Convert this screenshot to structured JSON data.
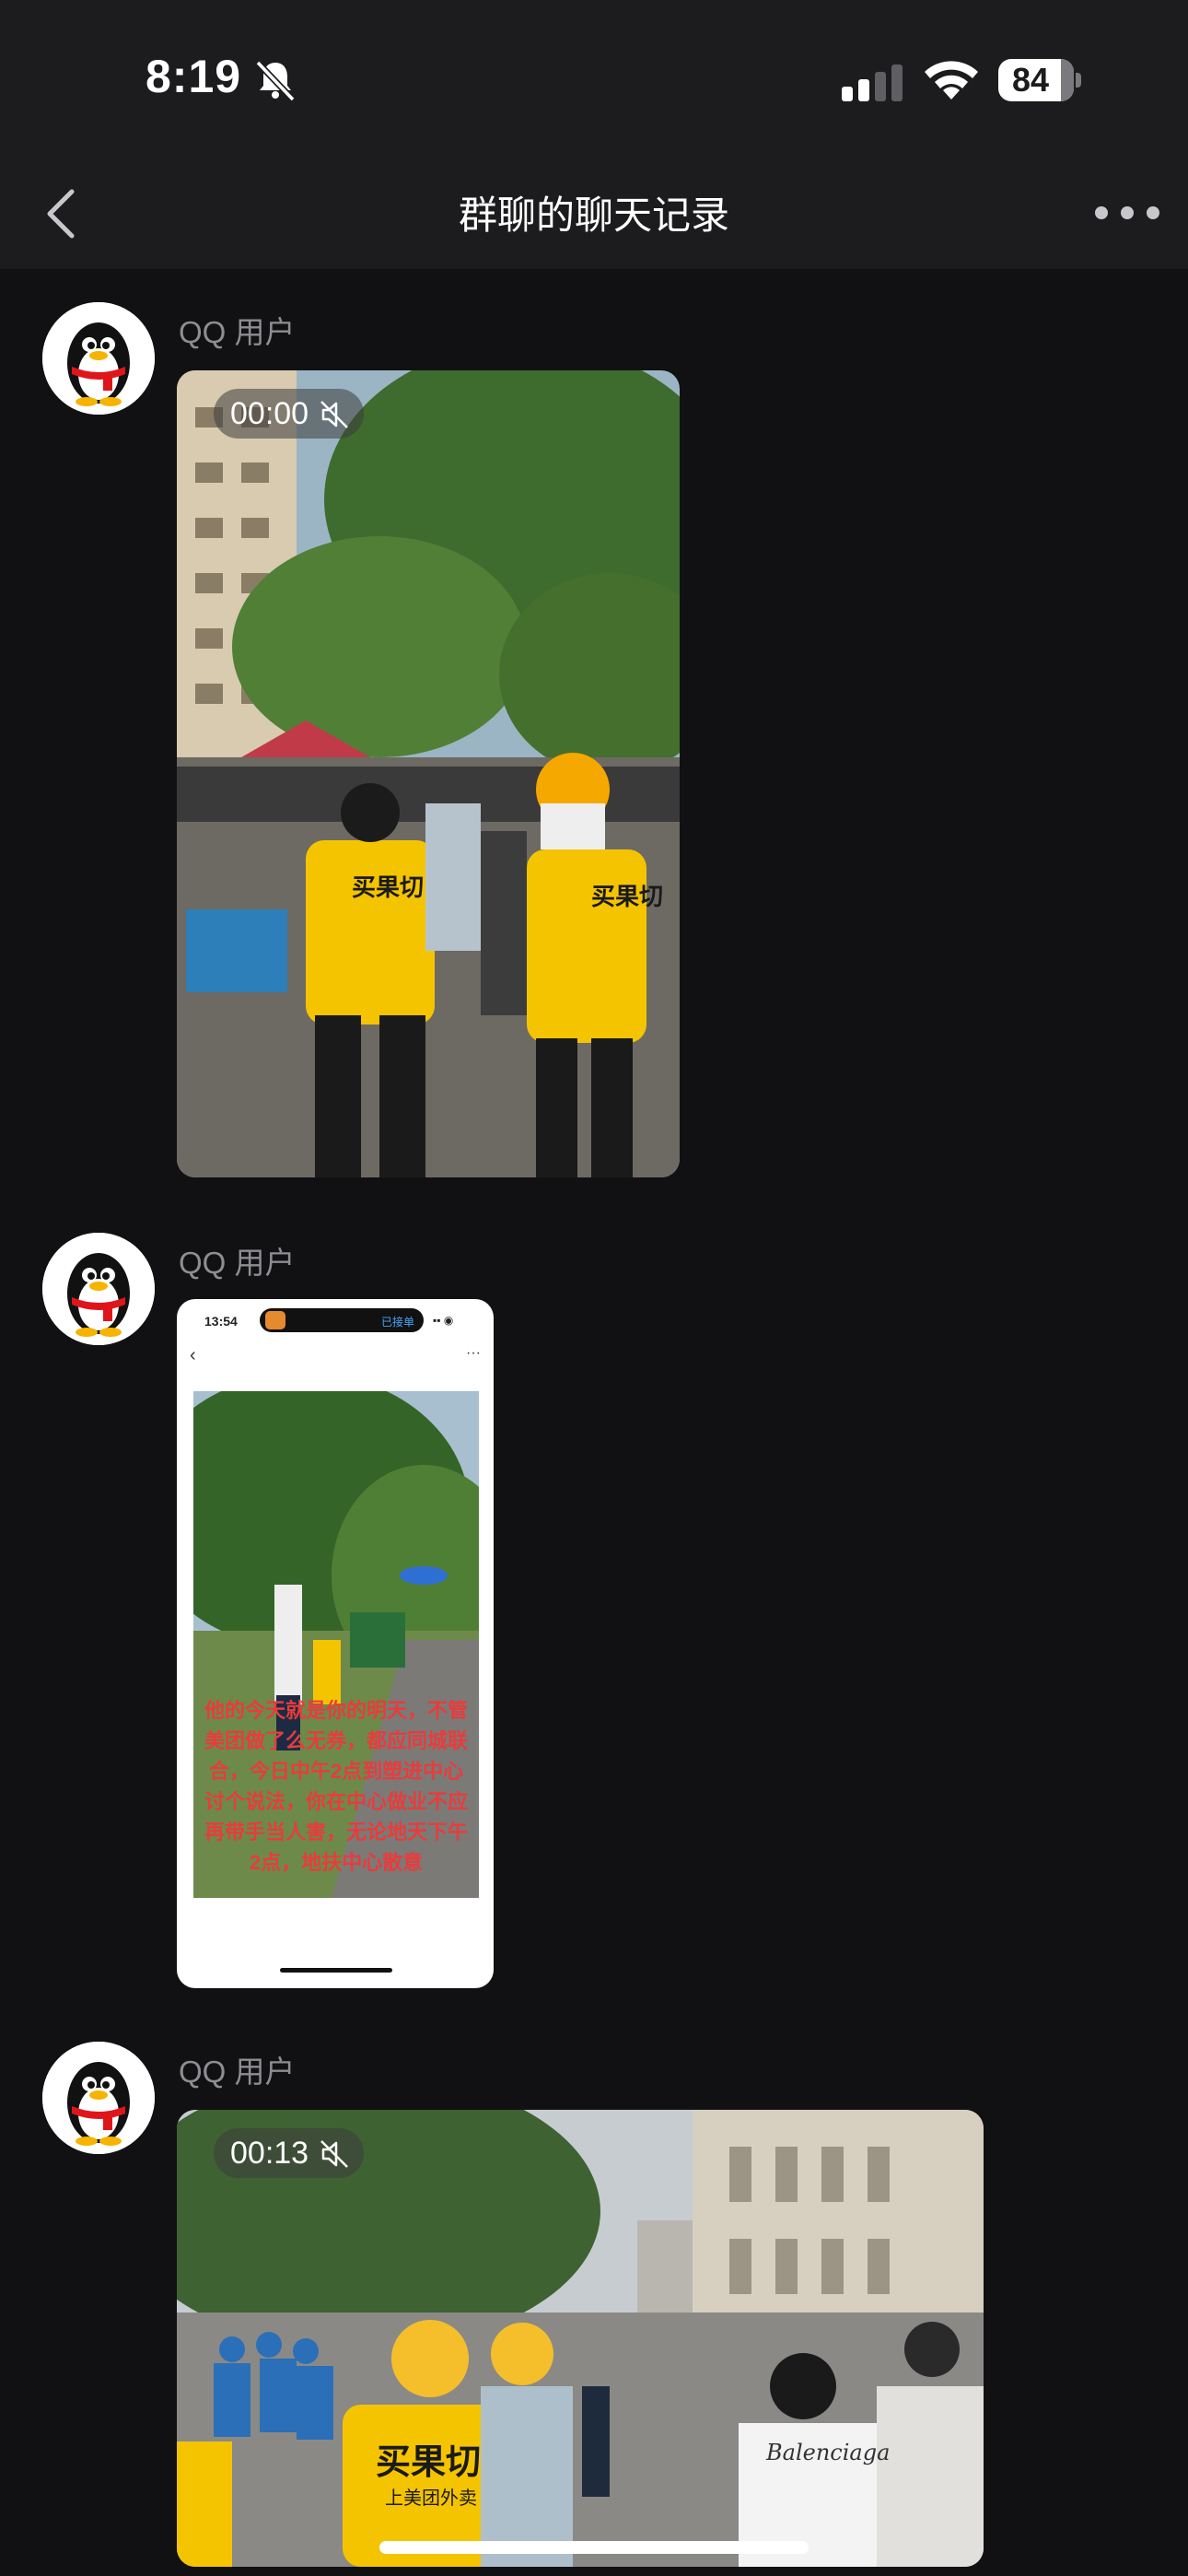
{
  "status_bar": {
    "time": "8:19",
    "battery": "84"
  },
  "nav": {
    "title": "群聊的聊天记录"
  },
  "messages": [
    {
      "sender": "QQ 用户",
      "video_time": "00:00"
    },
    {
      "sender": "QQ 用户",
      "screenshot": {
        "status_time": "13:54",
        "order_status": "已接单",
        "caption": "他的今天就是你的明天，不管美团做了么无券，都应同城联合，今日中午2点到塑进中心讨个说法，你在中心做业不应再带手当人害，无论地天下午2点，地扶中心散意"
      }
    },
    {
      "sender": "QQ 用户",
      "video_time": "00:13",
      "jersey_text": "买果切",
      "jersey_sub": "上美团外卖"
    }
  ],
  "colors": {
    "background": "#111113",
    "bar": "#1c1c1e",
    "jersey_yellow": "#f5c400"
  }
}
